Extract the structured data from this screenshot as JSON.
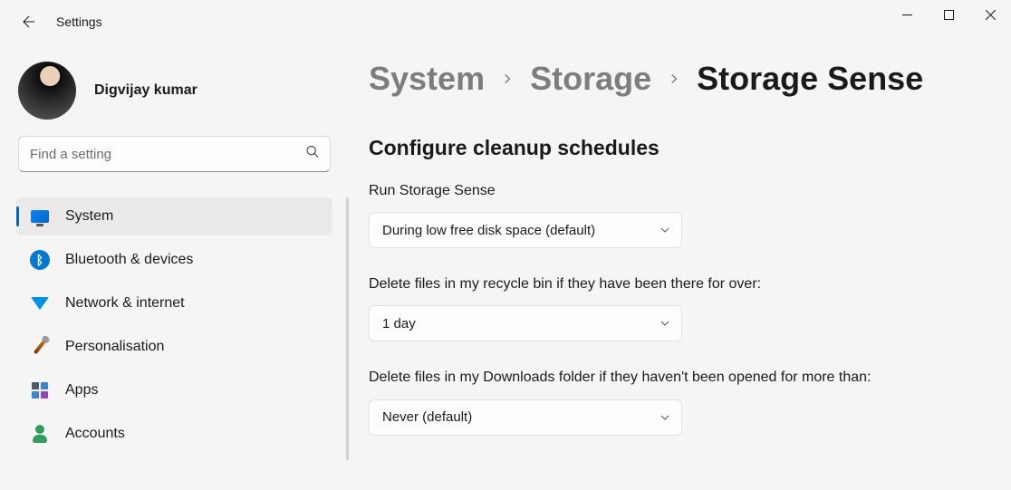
{
  "header": {
    "app_title": "Settings"
  },
  "user": {
    "name": "Digvijay kumar"
  },
  "search": {
    "placeholder": "Find a setting"
  },
  "sidebar": {
    "items": [
      {
        "label": "System"
      },
      {
        "label": "Bluetooth & devices"
      },
      {
        "label": "Network & internet"
      },
      {
        "label": "Personalisation"
      },
      {
        "label": "Apps"
      },
      {
        "label": "Accounts"
      }
    ]
  },
  "breadcrumb": {
    "level1": "System",
    "level2": "Storage",
    "current": "Storage Sense"
  },
  "main": {
    "section_heading": "Configure cleanup schedules",
    "group1": {
      "label": "Run Storage Sense",
      "value": "During low free disk space (default)"
    },
    "group2": {
      "label": "Delete files in my recycle bin if they have been there for over:",
      "value": "1 day"
    },
    "group3": {
      "label": "Delete files in my Downloads folder if they haven't been opened for more than:",
      "value": "Never (default)"
    }
  }
}
